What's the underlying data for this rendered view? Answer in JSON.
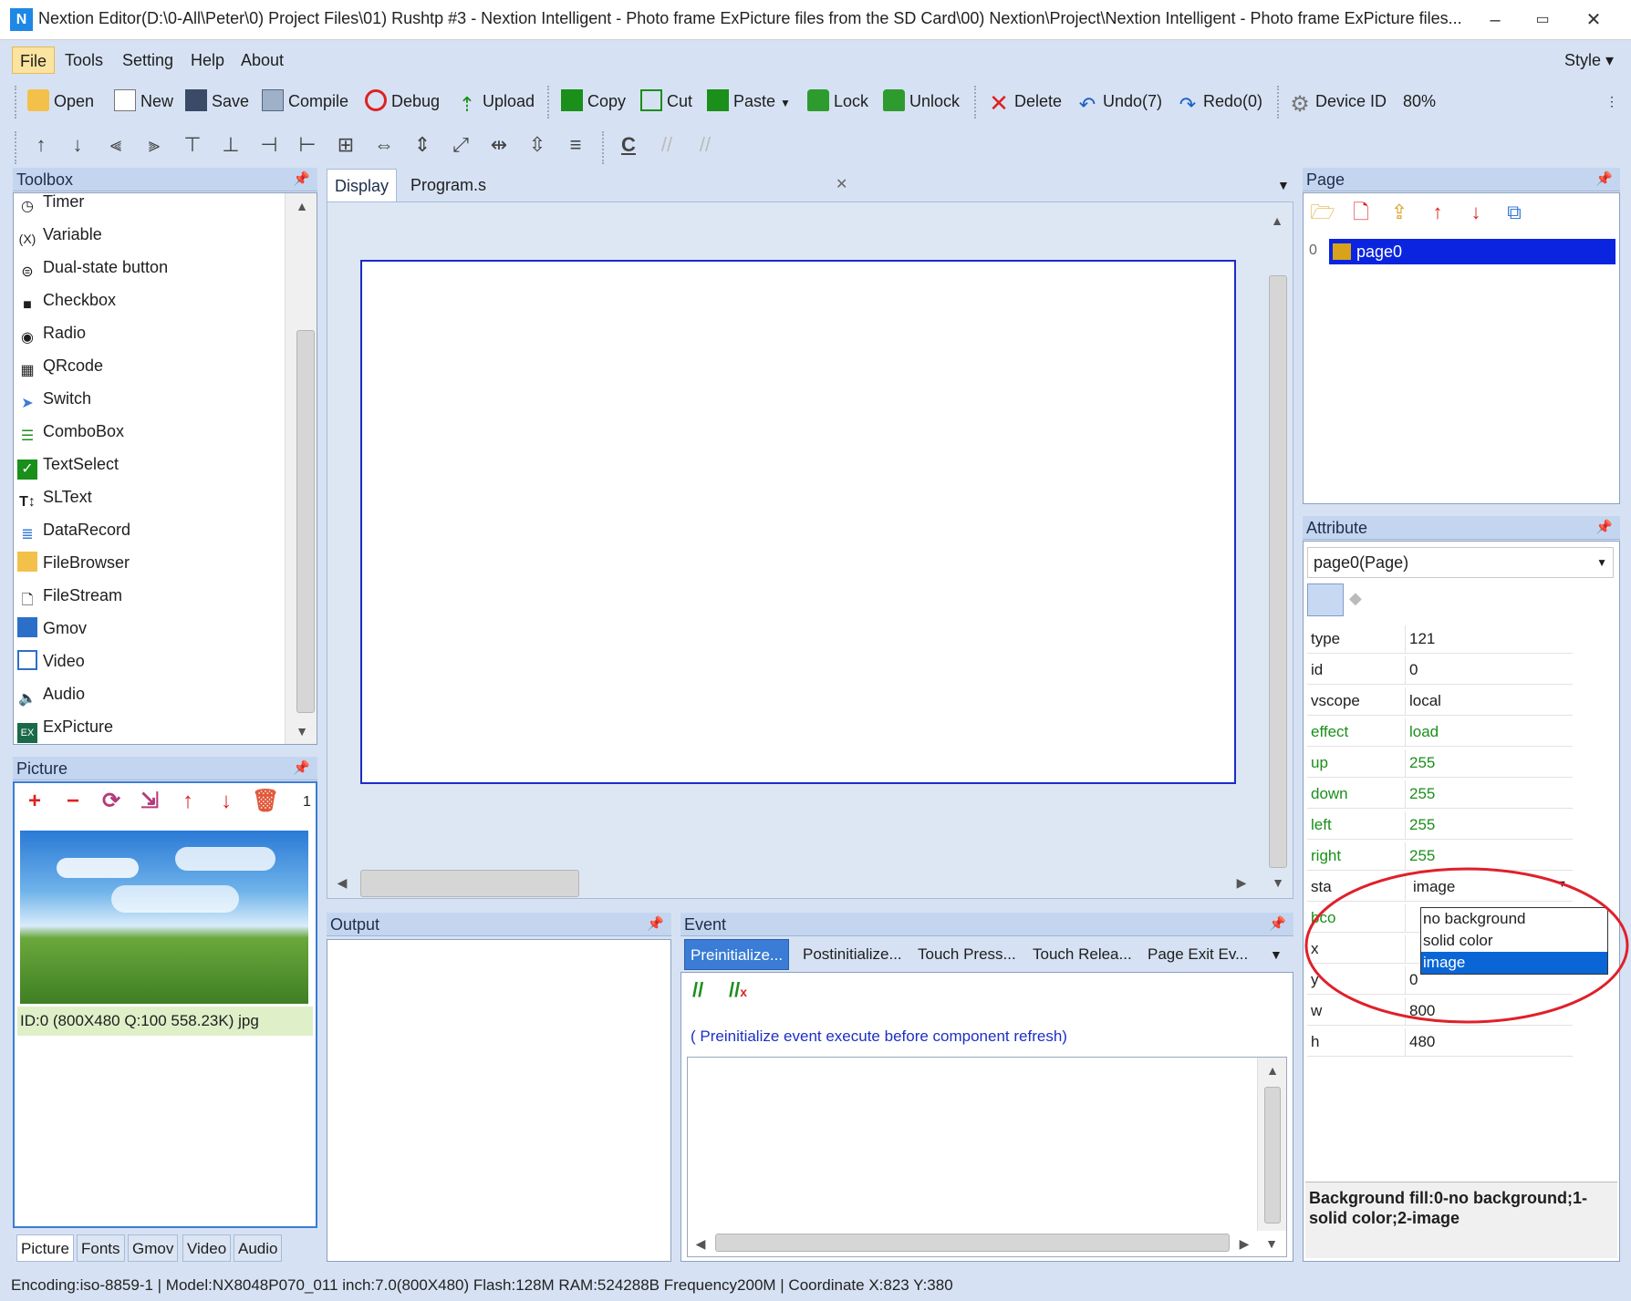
{
  "window": {
    "title": "Nextion Editor(D:\\0-All\\Peter\\0) Project Files\\01) Rushtp #3 - Nextion Intelligent - Photo frame ExPicture files from the SD Card\\00) Nextion\\Project\\Nextion Intelligent - Photo frame ExPicture files...",
    "logo": "N"
  },
  "menu": {
    "file": "File",
    "tools": "Tools",
    "setting": "Setting",
    "help": "Help",
    "about": "About",
    "style": "Style"
  },
  "toolbar": {
    "open": "Open",
    "new": "New",
    "save": "Save",
    "compile": "Compile",
    "debug": "Debug",
    "upload": "Upload",
    "copy": "Copy",
    "cut": "Cut",
    "paste": "Paste",
    "lock": "Lock",
    "unlock": "Unlock",
    "delete": "Delete",
    "undo": "Undo(7)",
    "redo": "Redo(0)",
    "device": "Device",
    "device_id": "ID",
    "zoom": "80%"
  },
  "toolbox": {
    "title": "Toolbox",
    "items": [
      "Timer",
      "Variable",
      "Dual-state button",
      "Checkbox",
      "Radio",
      "QRcode",
      "Switch",
      "ComboBox",
      "TextSelect",
      "SLText",
      "DataRecord",
      "FileBrowser",
      "FileStream",
      "Gmov",
      "Video",
      "Audio",
      "ExPicture"
    ]
  },
  "picture": {
    "title": "Picture",
    "count": "1",
    "caption": "ID:0  (800X480 Q:100 558.23K) jpg",
    "tabs": [
      "Picture",
      "Fonts",
      "Gmov",
      "Video",
      "Audio"
    ]
  },
  "center": {
    "tab_display": "Display",
    "tab_program": "Program.s",
    "close": "×"
  },
  "output": {
    "title": "Output"
  },
  "event": {
    "title": "Event",
    "tabs": [
      "Preinitialize...",
      "Postinitialize...",
      "Touch Press...",
      "Touch Relea...",
      "Page Exit Ev..."
    ],
    "hint": "( Preinitialize event execute before component refresh)"
  },
  "page_panel": {
    "title": "Page",
    "index": "0",
    "page": "page0"
  },
  "attribute": {
    "title": "Attribute",
    "object": "page0(Page)",
    "rows": [
      {
        "k": "type",
        "v": "121"
      },
      {
        "k": "id",
        "v": "0"
      },
      {
        "k": "vscope",
        "v": "local"
      },
      {
        "k": "effect",
        "v": "load"
      },
      {
        "k": "up",
        "v": "255"
      },
      {
        "k": "down",
        "v": "255"
      },
      {
        "k": "left",
        "v": "255"
      },
      {
        "k": "right",
        "v": "255"
      },
      {
        "k": "sta",
        "v": "image"
      },
      {
        "k": "bco",
        "v": ""
      },
      {
        "k": "x",
        "v": ""
      },
      {
        "k": "y",
        "v": "0"
      },
      {
        "k": "w",
        "v": "800"
      },
      {
        "k": "h",
        "v": "480"
      }
    ],
    "dropdown": [
      "no background",
      "solid color",
      "image"
    ],
    "help": "Background fill:0-no background;1-solid color;2-image"
  },
  "status": "Encoding:iso-8859-1 | Model:NX8048P070_011 inch:7.0(800X480) Flash:128M RAM:524288B Frequency200M |   Coordinate X:823  Y:380",
  "colors": {
    "accent": "#3a7cd6",
    "selection": "#0a24e0",
    "annotation": "#e0202a",
    "green_attr": "#1a8f1a"
  }
}
